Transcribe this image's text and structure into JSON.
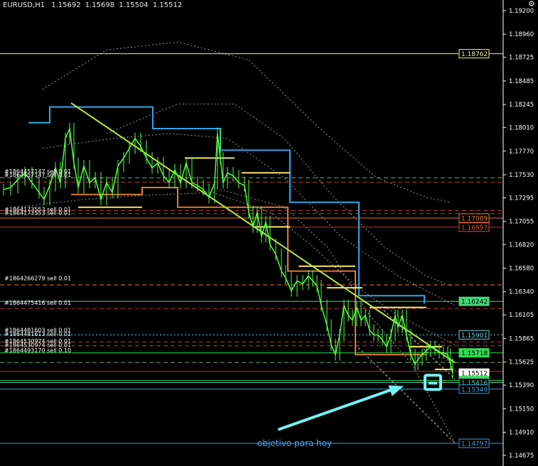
{
  "chart_data": {
    "type": "candlestick",
    "symbol": "EURUSD,H1",
    "ohlc": {
      "open": "1.15692",
      "high": "1.15698",
      "low": "1.15504",
      "close": "1.15512"
    },
    "y_axis": {
      "range": [
        1.14675,
        1.192
      ],
      "ticks": [
        "1.19200",
        "1.18960",
        "1.18725",
        "1.18485",
        "1.18245",
        "1.18010",
        "1.17770",
        "1.17530",
        "1.17295",
        "1.17055",
        "1.16820",
        "1.16580",
        "1.16340",
        "1.16105",
        "1.15865",
        "1.15625",
        "1.15390",
        "1.15150",
        "1.14910",
        "1.14675"
      ]
    },
    "price_labels": [
      {
        "text": "1.18762",
        "value": 1.18762,
        "color": "#f2f291",
        "fill": "#000000",
        "text_color": "#f2f291"
      },
      {
        "text": "1.17089",
        "value": 1.17089,
        "color": "#e07a35",
        "fill": "#000000",
        "text_color": "#e07a35"
      },
      {
        "text": "1.16997",
        "value": 1.16997,
        "color": "#e04a35",
        "fill": "#000000",
        "text_color": "#e04a35"
      },
      {
        "text": "1.16242",
        "value": 1.16242,
        "color": "#42d67a",
        "fill": "#42d67a",
        "text_color": "#000000"
      },
      {
        "text": "1.15901",
        "value": 1.15901,
        "color": "#6fd0d8",
        "fill": "#000000",
        "text_color": "#6fd0d8"
      },
      {
        "text": "1.15718",
        "value": 1.15718,
        "color": "#2fdf50",
        "fill": "#2fdf50",
        "text_color": "#000000"
      },
      {
        "text": "1.15512",
        "value": 1.15512,
        "color": "#ffffff",
        "fill": "#ffffff",
        "text_color": "#000000"
      },
      {
        "text": "1.15437",
        "value": 1.15437,
        "color": "#2fdf50",
        "fill": "#2fdf50",
        "text_color": "#000000"
      },
      {
        "text": "1.15416",
        "value": 1.15416,
        "color": "#4fc8a0",
        "fill": "#000000",
        "text_color": "#4fc8a0"
      },
      {
        "text": "1.15349",
        "value": 1.15349,
        "color": "#3f9ad8",
        "fill": "#000000",
        "text_color": "#3f9ad8"
      },
      {
        "text": "1.14797",
        "value": 1.14797,
        "color": "#3f9ad8",
        "fill": "#000000",
        "text_color": "#3f9ad8"
      }
    ],
    "horizontal_lines": [
      {
        "value": 1.18762,
        "color": "#f2f291",
        "style": "solid"
      },
      {
        "value": 1.175,
        "color": "#5fb35f",
        "style": "dashed"
      },
      {
        "value": 1.17455,
        "color": "#c0392b",
        "style": "dashed"
      },
      {
        "value": 1.17165,
        "color": "#c0392b",
        "style": "dashed"
      },
      {
        "value": 1.17135,
        "color": "#c0392b",
        "style": "dashed"
      },
      {
        "value": 1.17089,
        "color": "#e07a35",
        "style": "solid"
      },
      {
        "value": 1.16997,
        "color": "#c0392b",
        "style": "solid"
      },
      {
        "value": 1.1641,
        "color": "#e07a35",
        "style": "dashed"
      },
      {
        "value": 1.16242,
        "color": "#42d67a",
        "style": "solid"
      },
      {
        "value": 1.1617,
        "color": "#c0392b",
        "style": "dashed"
      },
      {
        "value": 1.15901,
        "color": "#6fd0d8",
        "style": "dotted"
      },
      {
        "value": 1.1583,
        "color": "#c0392b",
        "style": "dashed"
      },
      {
        "value": 1.1579,
        "color": "#c0392b",
        "style": "dashed"
      },
      {
        "value": 1.15718,
        "color": "#2fdf50",
        "style": "solid"
      },
      {
        "value": 1.1562,
        "color": "#5fb35f",
        "style": "dashed"
      },
      {
        "value": 1.1553,
        "color": "#c0392b",
        "style": "solid"
      },
      {
        "value": 1.15437,
        "color": "#2fdf50",
        "style": "solid"
      },
      {
        "value": 1.15416,
        "color": "#4fc8a0",
        "style": "solid"
      },
      {
        "value": 1.15349,
        "color": "#3f9ad8",
        "style": "solid"
      },
      {
        "value": 1.14797,
        "color": "#3f9ad8",
        "style": "solid"
      }
    ],
    "order_labels": [
      {
        "text": "#1864457147 sell 0.01",
        "value": 1.17565
      },
      {
        "text": "#1864457147 sell 0.01",
        "value": 1.1753
      },
      {
        "text": "#1864173553 sell 0.01",
        "value": 1.1718
      },
      {
        "text": "#1864173553 sell 0.01",
        "value": 1.17145
      },
      {
        "text": "#1864266279 sell 0.01",
        "value": 1.1648
      },
      {
        "text": "#1864475416 sell 0.01",
        "value": 1.1623
      },
      {
        "text": "#1864481603 sell 0.01",
        "value": 1.1595
      },
      {
        "text": "#1864481613 sell 0.01",
        "value": 1.1591
      },
      {
        "text": "#1864530974 sell 0.01",
        "value": 1.1584
      },
      {
        "text": "#1864530974 sell 0.01",
        "value": 1.158
      },
      {
        "text": "#1864493170 sell 0.10",
        "value": 1.15745
      }
    ],
    "price_path": [
      [
        5,
        1.1738
      ],
      [
        15,
        1.174
      ],
      [
        25,
        1.1748
      ],
      [
        35,
        1.1755
      ],
      [
        45,
        1.1745
      ],
      [
        55,
        1.1735
      ],
      [
        62,
        1.1728
      ],
      [
        70,
        1.1742
      ],
      [
        78,
        1.176
      ],
      [
        85,
        1.1745
      ],
      [
        92,
        1.179
      ],
      [
        98,
        1.18
      ],
      [
        104,
        1.1765
      ],
      [
        110,
        1.174
      ],
      [
        118,
        1.1762
      ],
      [
        126,
        1.1745
      ],
      [
        134,
        1.175
      ],
      [
        142,
        1.1728
      ],
      [
        150,
        1.1745
      ],
      [
        158,
        1.1735
      ],
      [
        166,
        1.1762
      ],
      [
        174,
        1.177
      ],
      [
        182,
        1.178
      ],
      [
        190,
        1.179
      ],
      [
        198,
        1.1782
      ],
      [
        206,
        1.177
      ],
      [
        214,
        1.176
      ],
      [
        222,
        1.1765
      ],
      [
        230,
        1.1752
      ],
      [
        238,
        1.1745
      ],
      [
        246,
        1.1758
      ],
      [
        254,
        1.1745
      ],
      [
        262,
        1.1765
      ],
      [
        270,
        1.1745
      ],
      [
        278,
        1.1742
      ],
      [
        286,
        1.1738
      ],
      [
        294,
        1.173
      ],
      [
        302,
        1.1745
      ],
      [
        306,
        1.1795
      ],
      [
        310,
        1.177
      ],
      [
        314,
        1.1745
      ],
      [
        320,
        1.1755
      ],
      [
        328,
        1.1752
      ],
      [
        336,
        1.1745
      ],
      [
        344,
        1.1742
      ],
      [
        350,
        1.1715
      ],
      [
        356,
        1.17
      ],
      [
        362,
        1.1715
      ],
      [
        368,
        1.169
      ],
      [
        374,
        1.1705
      ],
      [
        380,
        1.1682
      ],
      [
        388,
        1.1672
      ],
      [
        396,
        1.1655
      ],
      [
        402,
        1.1648
      ],
      [
        410,
        1.1635
      ],
      [
        418,
        1.1645
      ],
      [
        426,
        1.1642
      ],
      [
        434,
        1.165
      ],
      [
        440,
        1.1645
      ],
      [
        446,
        1.164
      ],
      [
        452,
        1.162
      ],
      [
        460,
        1.16
      ],
      [
        466,
        1.158
      ],
      [
        472,
        1.157
      ],
      [
        478,
        1.159
      ],
      [
        484,
        1.162
      ],
      [
        490,
        1.161
      ],
      [
        496,
        1.1605
      ],
      [
        502,
        1.1618
      ],
      [
        508,
        1.1605
      ],
      [
        514,
        1.161
      ],
      [
        520,
        1.1595
      ],
      [
        526,
        1.159
      ],
      [
        532,
        1.159
      ],
      [
        538,
        1.1585
      ],
      [
        544,
        1.1578
      ],
      [
        550,
        1.159
      ],
      [
        556,
        1.161
      ],
      [
        560,
        1.1598
      ],
      [
        566,
        1.161
      ],
      [
        572,
        1.159
      ],
      [
        578,
        1.157
      ],
      [
        584,
        1.156
      ],
      [
        588,
        1.1565
      ],
      [
        594,
        1.157
      ],
      [
        600,
        1.1574
      ],
      [
        606,
        1.1578
      ],
      [
        612,
        1.1575
      ],
      [
        618,
        1.1572
      ],
      [
        624,
        1.1572
      ],
      [
        630,
        1.157
      ],
      [
        634,
        1.156
      ],
      [
        637,
        1.1551
      ]
    ],
    "trendline": [
      [
        100,
        1.1826
      ],
      [
        640,
        1.1562
      ]
    ],
    "annotation": {
      "text": "objetivo para hoy",
      "color": "#3fa6ff"
    },
    "arrow": {
      "from": [
        393,
        1.1494
      ],
      "to": [
        568,
        1.1538
      ],
      "color": "#74f2f4"
    },
    "target_box": {
      "center": [
        609,
        1.1541
      ],
      "color": "#74f2f4"
    },
    "colors": {
      "background": "#000000",
      "price": "#50ff40",
      "axis": "#ffffff",
      "trendline": "#b8e63c",
      "stairs_blue": "#2fa6e8",
      "stairs_orange": "#e07a35",
      "stairs_yellow": "#f5e66a"
    }
  }
}
